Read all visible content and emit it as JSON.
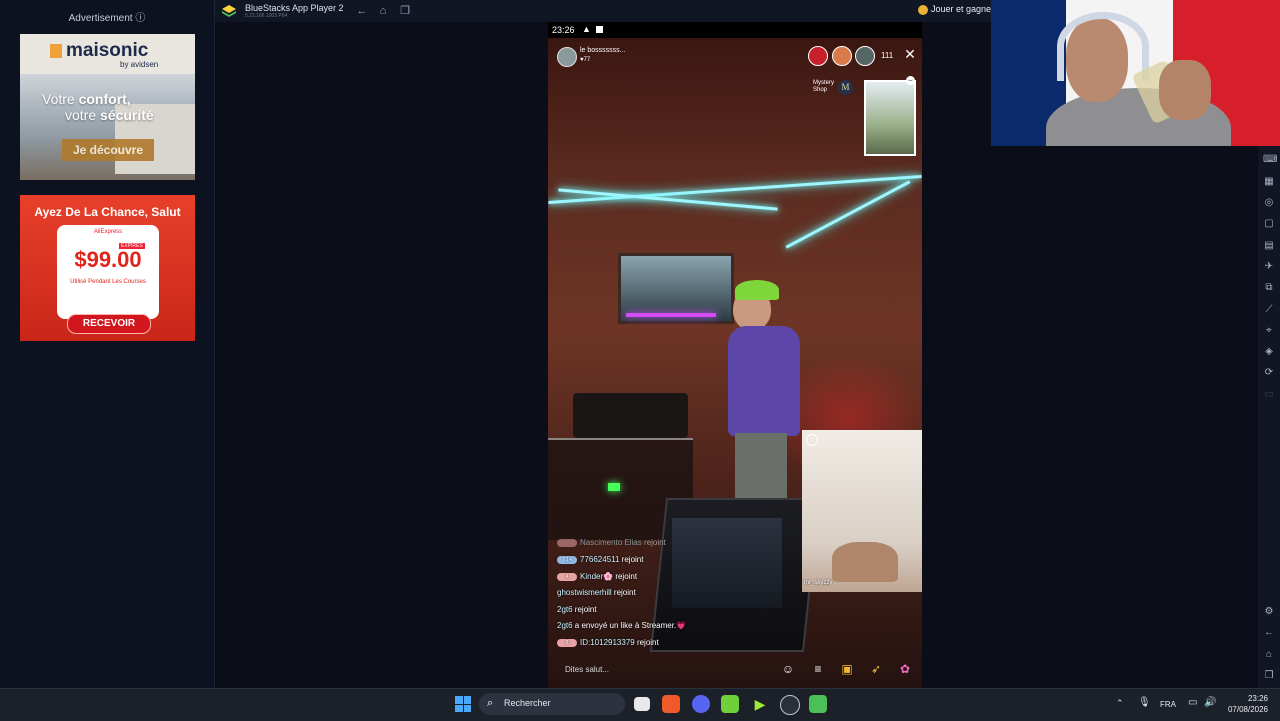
{
  "ads": {
    "title": "Advertisement ⓘ",
    "ad1": {
      "brand": "maisonic",
      "by": "by avidsen",
      "line1_pre": "Votre ",
      "line1_bold": "confort,",
      "line2_pre": "votre ",
      "line2_bold": "sécurité",
      "cta": "Je découvre"
    },
    "ad2": {
      "headline": "Ayez De La Chance, Salut",
      "brand": "AliExpress",
      "expires": "EXPIRES",
      "price": "$99.00",
      "sub": "Utilisé Pendant Les Courses",
      "cta": "RECEVOIR"
    }
  },
  "bluestacks": {
    "title": "BlueStacks App Player 2",
    "version": "5.22.166.1003 P64",
    "promo": "Jouer et gagner"
  },
  "phone": {
    "status_time": "23:26",
    "host_name": "le bosssssss...",
    "host_likes": "♥77",
    "viewer_count": "111",
    "shop_label": "Mystery Shop",
    "shop_badge": "M",
    "guest_name": "mr_skyzzy",
    "comment_placeholder": "Dites salut...",
    "chat": [
      {
        "level": "",
        "user": "Nascimento Elias",
        "text": " rejoint",
        "dim": true
      },
      {
        "level": "7 14",
        "user": "776624511",
        "text": " rejoint"
      },
      {
        "level": "4",
        "user": "Kinder🌸",
        "text": " rejoint"
      },
      {
        "level": "",
        "user": "ghostwismerhill",
        "text": " rejoint"
      },
      {
        "level": "",
        "user": "2gt6",
        "text": " rejoint"
      },
      {
        "level": "",
        "user": "2gt6",
        "text": " a envoyé un like à Streamer.💗"
      },
      {
        "level": "6",
        "user": "ID:1012913379",
        "text": " rejoint"
      }
    ]
  },
  "taskbar": {
    "search": "Rechercher",
    "lang": "FRA",
    "time": "23:26",
    "date": "07/08/2026"
  },
  "colors": {
    "taskbar": "#1c2029",
    "accent": "#4aa8ff",
    "flag_blue": "#0b2a6b",
    "flag_red": "#d61f2b"
  }
}
